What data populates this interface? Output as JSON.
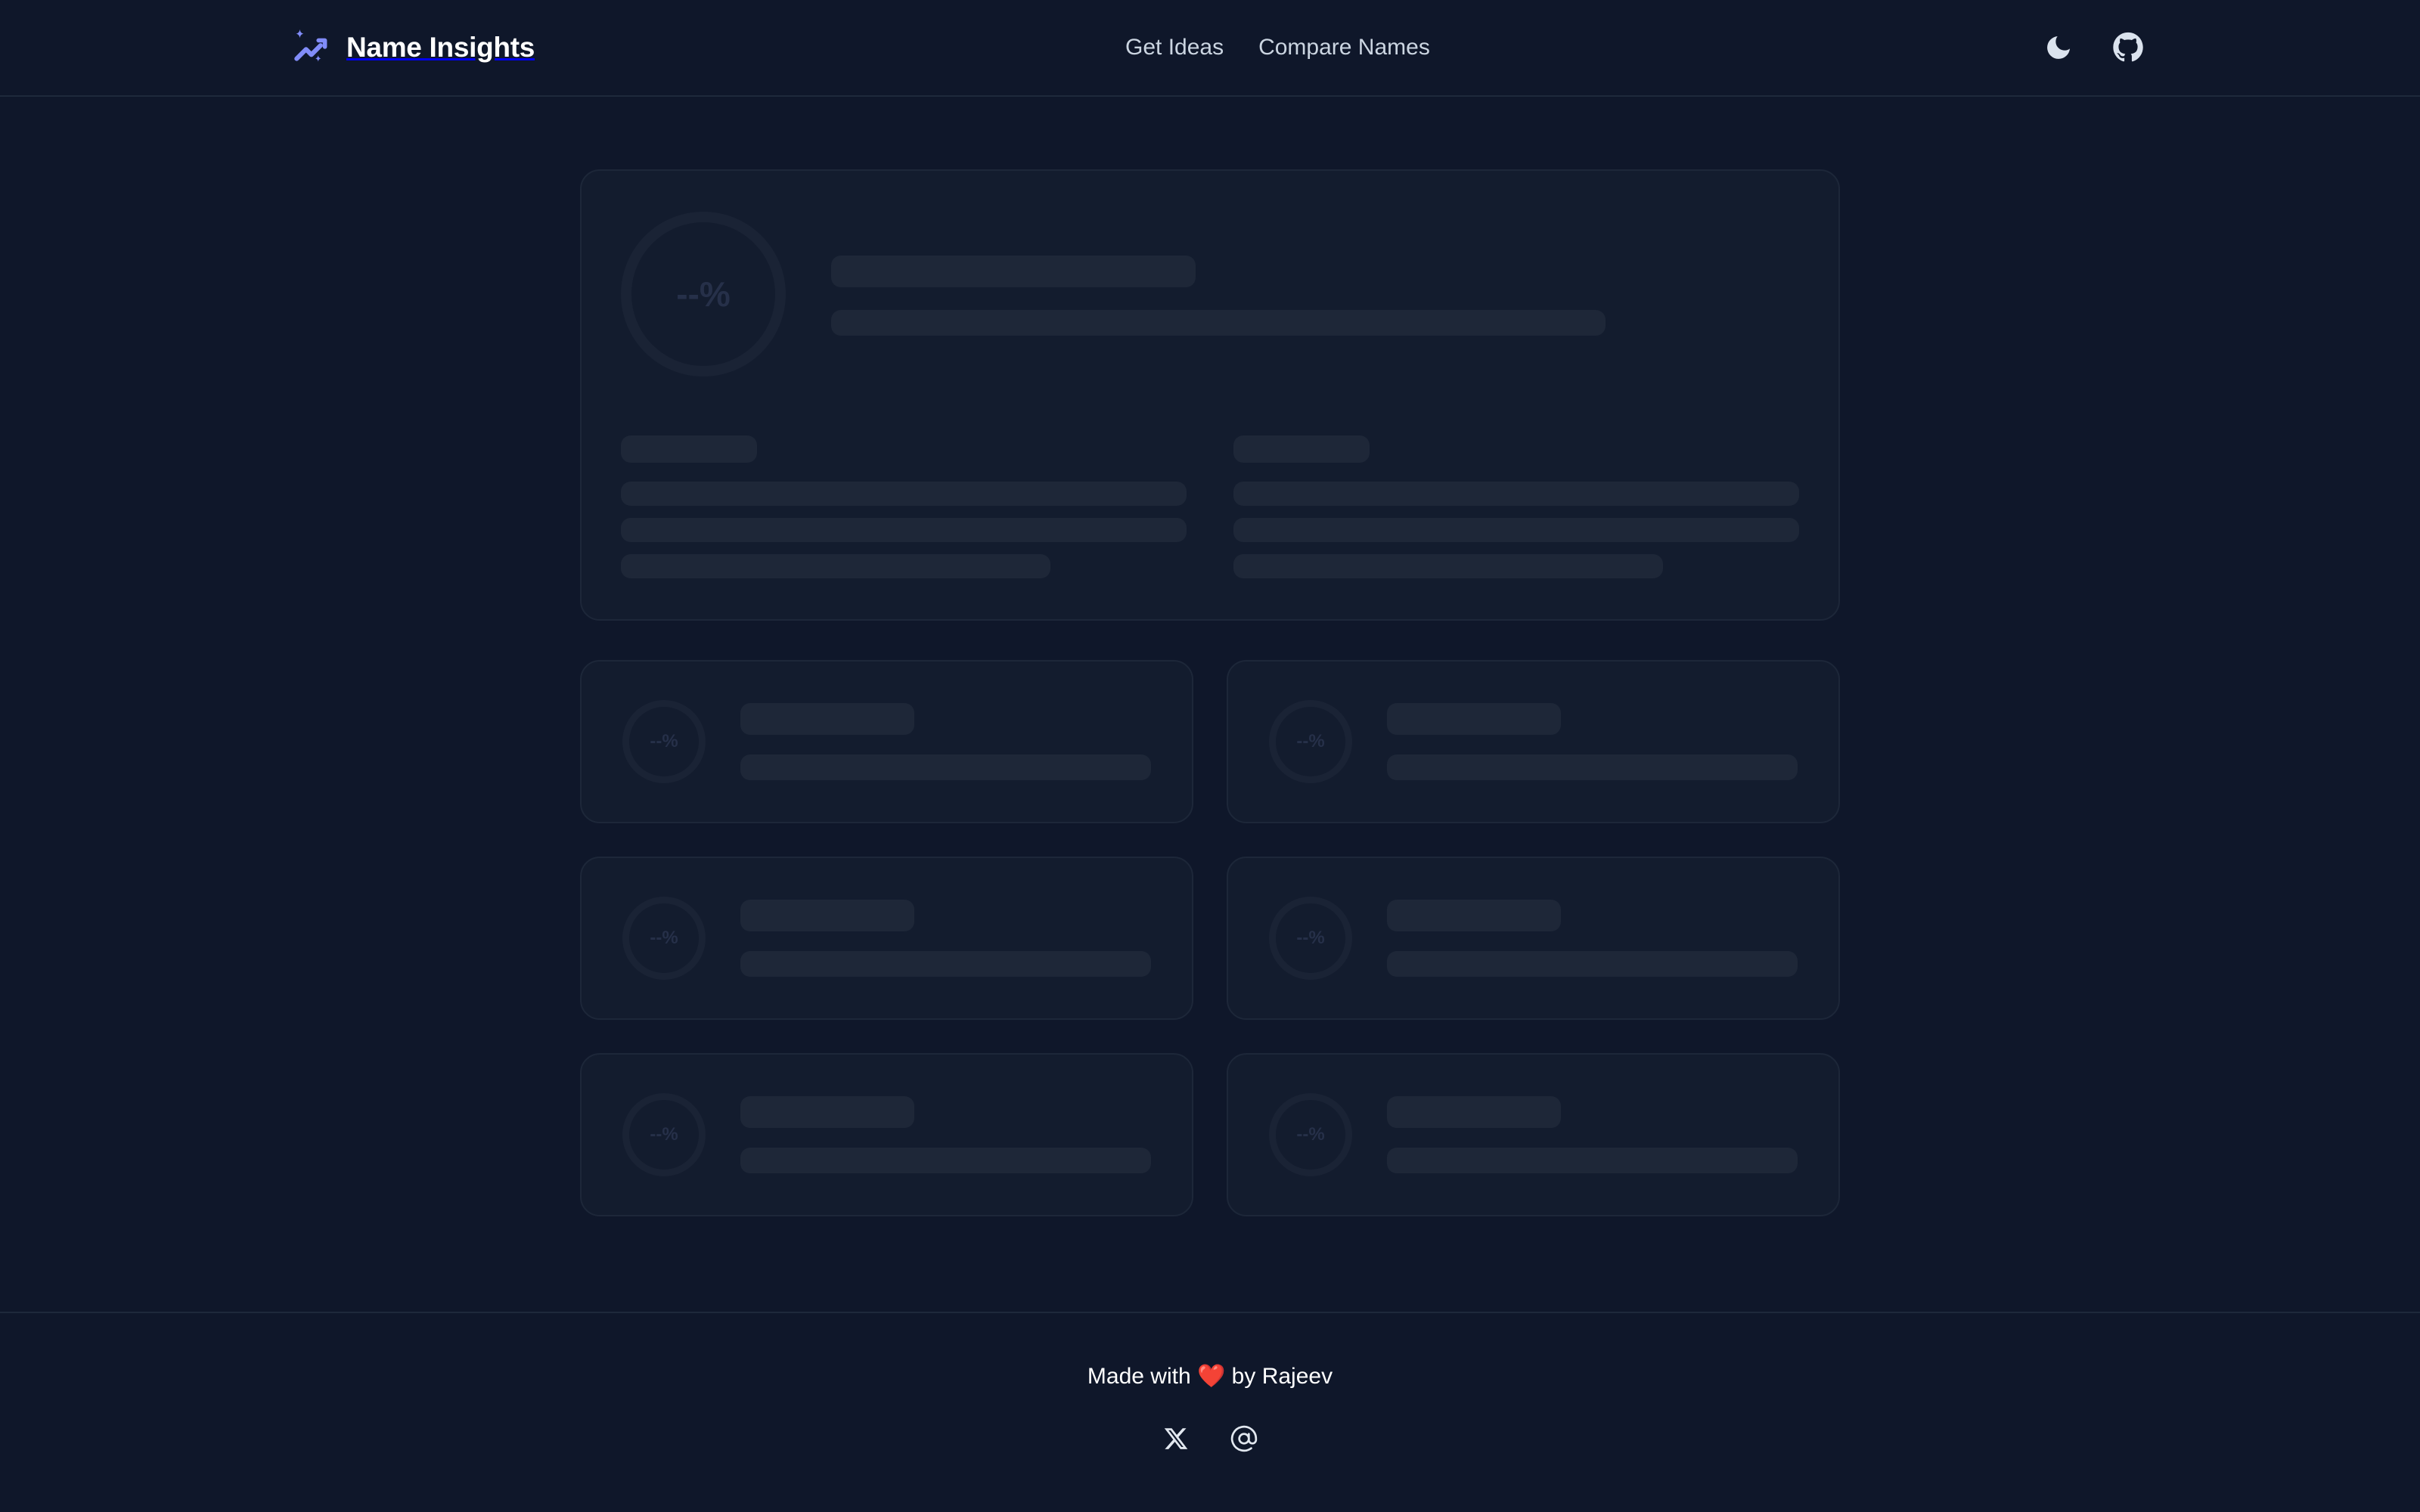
{
  "header": {
    "brand": {
      "title": "Name Insights",
      "icon": "trending-up-sparkle-icon",
      "icon_color": "#818cf8"
    },
    "nav": [
      {
        "label": "Get Ideas"
      },
      {
        "label": "Compare Names"
      }
    ],
    "actions": [
      {
        "name": "theme-toggle",
        "icon": "moon-icon"
      },
      {
        "name": "github-link",
        "icon": "github-icon"
      }
    ]
  },
  "main": {
    "state": "loading-skeleton",
    "hero": {
      "score_placeholder": "--%",
      "columns": [
        {
          "rows": 3
        },
        {
          "rows": 3
        }
      ]
    },
    "cards": [
      {
        "score_placeholder": "--%"
      },
      {
        "score_placeholder": "--%"
      },
      {
        "score_placeholder": "--%"
      },
      {
        "score_placeholder": "--%"
      },
      {
        "score_placeholder": "--%"
      },
      {
        "score_placeholder": "--%"
      }
    ]
  },
  "footer": {
    "credit": "Made with ❤️ by Rajeev",
    "socials": [
      {
        "name": "x-twitter-link",
        "icon": "x-icon"
      },
      {
        "name": "email-link",
        "icon": "at-icon"
      }
    ]
  },
  "colors": {
    "page_bg": "#0f172a",
    "card_bg": "#131c2e",
    "card_border": "#1d2739",
    "skeleton": "#1e2738",
    "accent": "#818cf8",
    "text": "#ffffff",
    "nav_text": "#cbd5e1",
    "heart": "#ef4444"
  }
}
